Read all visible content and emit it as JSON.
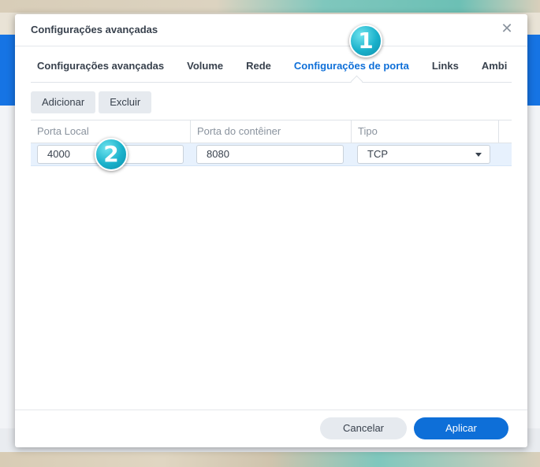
{
  "dialog": {
    "title": "Configurações avançadas"
  },
  "tabs": [
    {
      "label": "Configurações avançadas",
      "active": false
    },
    {
      "label": "Volume",
      "active": false
    },
    {
      "label": "Rede",
      "active": false
    },
    {
      "label": "Configurações de porta",
      "active": true
    },
    {
      "label": "Links",
      "active": false
    },
    {
      "label": "Ambi",
      "active": false
    }
  ],
  "toolbar": {
    "add_label": "Adicionar",
    "delete_label": "Excluir"
  },
  "grid": {
    "columns": [
      "Porta Local",
      "Porta do contêiner",
      "Tipo"
    ],
    "rows": [
      {
        "local_port": "4000",
        "container_port": "8080",
        "type": "TCP"
      }
    ]
  },
  "callouts": {
    "first": "1",
    "second": "2"
  },
  "footer": {
    "cancel_label": "Cancelar",
    "apply_label": "Aplicar"
  },
  "colors": {
    "accent": "#0e6fd8",
    "app_bar": "#1674e4",
    "callout": "#1ab1cb"
  }
}
